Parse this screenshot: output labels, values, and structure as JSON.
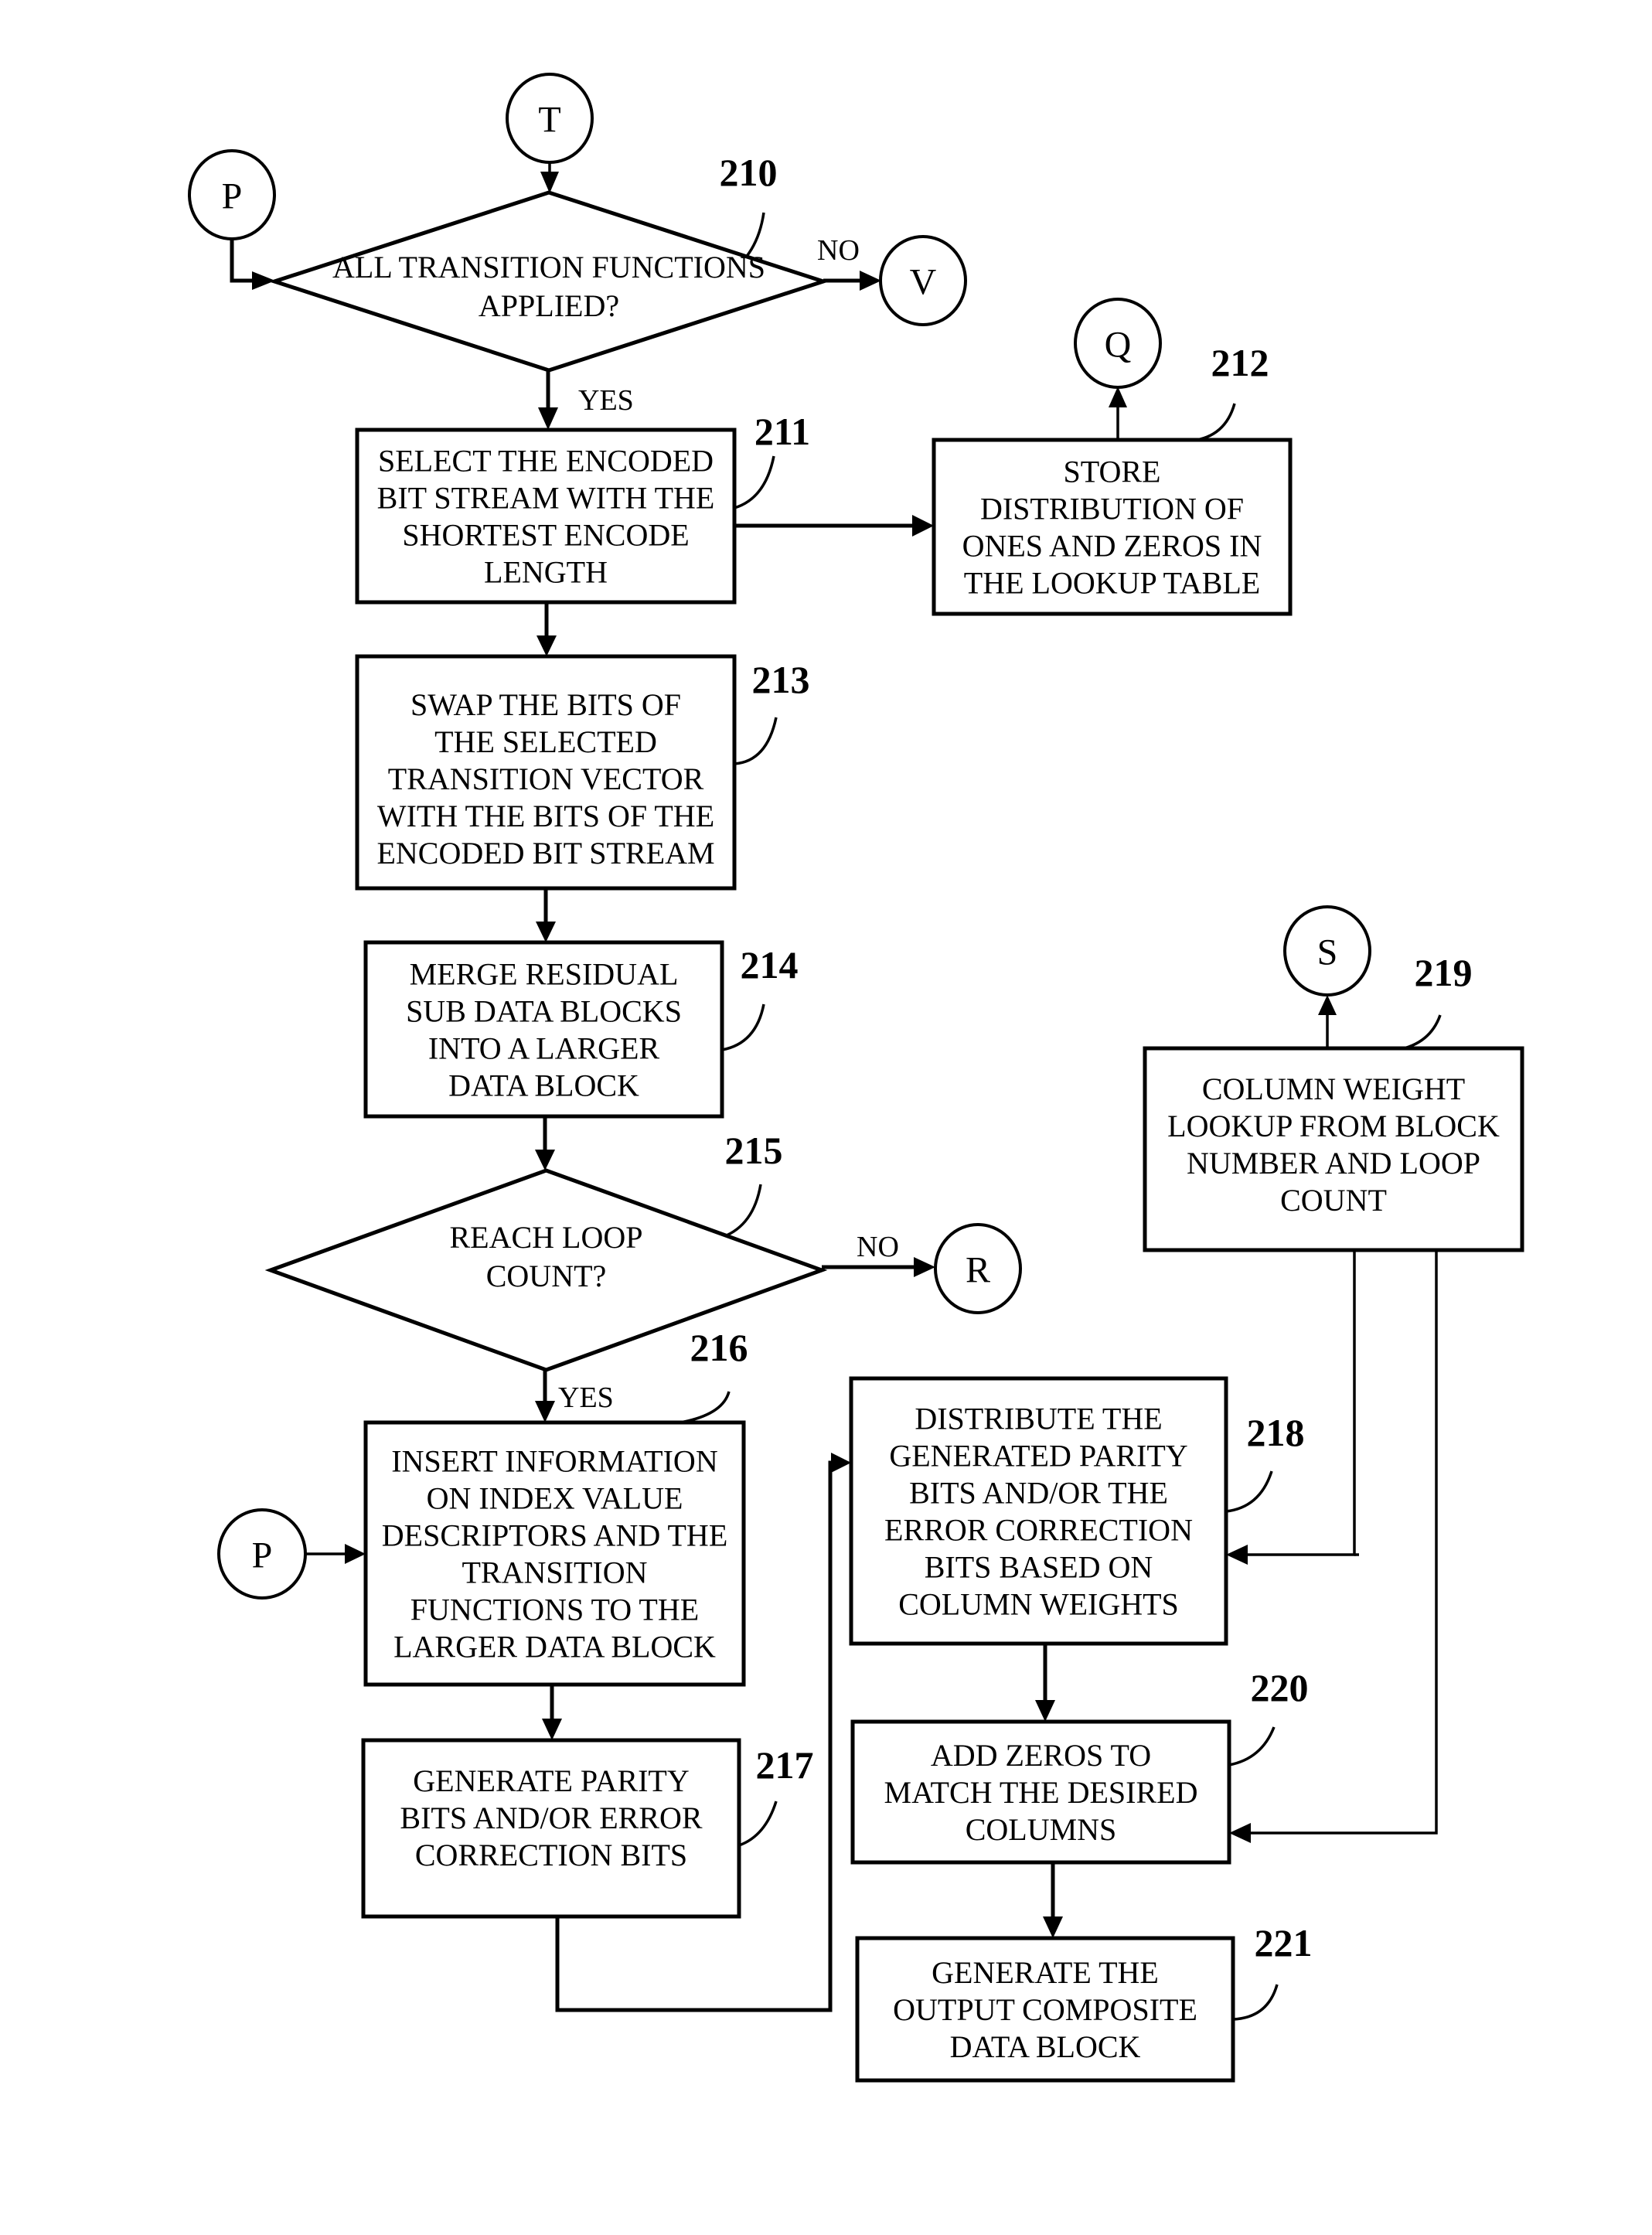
{
  "figure": {
    "connectors": {
      "T": "T",
      "P_top": "P",
      "V": "V",
      "Q": "Q",
      "R": "R",
      "S": "S",
      "P_bottom": "P"
    },
    "branch_labels": {
      "d210_no": "NO",
      "d210_yes": "YES",
      "d215_no": "NO",
      "d215_yes": "YES"
    },
    "steps": {
      "s210": {
        "ref": "210",
        "type": "decision",
        "lines": [
          "ALL TRANSITION FUNCTIONS",
          "APPLIED?"
        ]
      },
      "s211": {
        "ref": "211",
        "type": "process",
        "lines": [
          "SELECT THE ENCODED",
          "BIT STREAM WITH THE",
          "SHORTEST ENCODE",
          "LENGTH"
        ]
      },
      "s212": {
        "ref": "212",
        "type": "process",
        "lines": [
          "STORE",
          "DISTRIBUTION OF",
          "ONES AND ZEROS IN",
          "THE LOOKUP TABLE"
        ]
      },
      "s213": {
        "ref": "213",
        "type": "process",
        "lines": [
          "SWAP THE BITS OF",
          "THE SELECTED",
          "TRANSITION VECTOR",
          "WITH THE BITS OF THE",
          "ENCODED BIT STREAM"
        ]
      },
      "s214": {
        "ref": "214",
        "type": "process",
        "lines": [
          "MERGE RESIDUAL",
          "SUB DATA BLOCKS",
          "INTO A LARGER",
          "DATA BLOCK"
        ]
      },
      "s215": {
        "ref": "215",
        "type": "decision",
        "lines": [
          "REACH LOOP",
          "COUNT?"
        ]
      },
      "s216": {
        "ref": "216",
        "type": "process",
        "lines": [
          "INSERT INFORMATION",
          "ON INDEX VALUE",
          "DESCRIPTORS AND THE",
          "TRANSITION",
          "FUNCTIONS TO THE",
          "LARGER DATA BLOCK"
        ]
      },
      "s217": {
        "ref": "217",
        "type": "process",
        "lines": [
          "GENERATE PARITY",
          "BITS AND/OR ERROR",
          "CORRECTION BITS"
        ]
      },
      "s218": {
        "ref": "218",
        "type": "process",
        "lines": [
          "DISTRIBUTE THE",
          "GENERATED PARITY",
          "BITS AND/OR THE",
          "ERROR CORRECTION",
          "BITS BASED ON",
          "COLUMN WEIGHTS"
        ]
      },
      "s219": {
        "ref": "219",
        "type": "process",
        "lines": [
          "COLUMN WEIGHT",
          "LOOKUP FROM BLOCK",
          "NUMBER AND LOOP",
          "COUNT"
        ]
      },
      "s220": {
        "ref": "220",
        "type": "process",
        "lines": [
          "ADD ZEROS TO",
          "MATCH THE DESIRED",
          "COLUMNS"
        ]
      },
      "s221": {
        "ref": "221",
        "type": "process",
        "lines": [
          "GENERATE THE",
          "OUTPUT COMPOSITE",
          "DATA BLOCK"
        ]
      }
    }
  }
}
